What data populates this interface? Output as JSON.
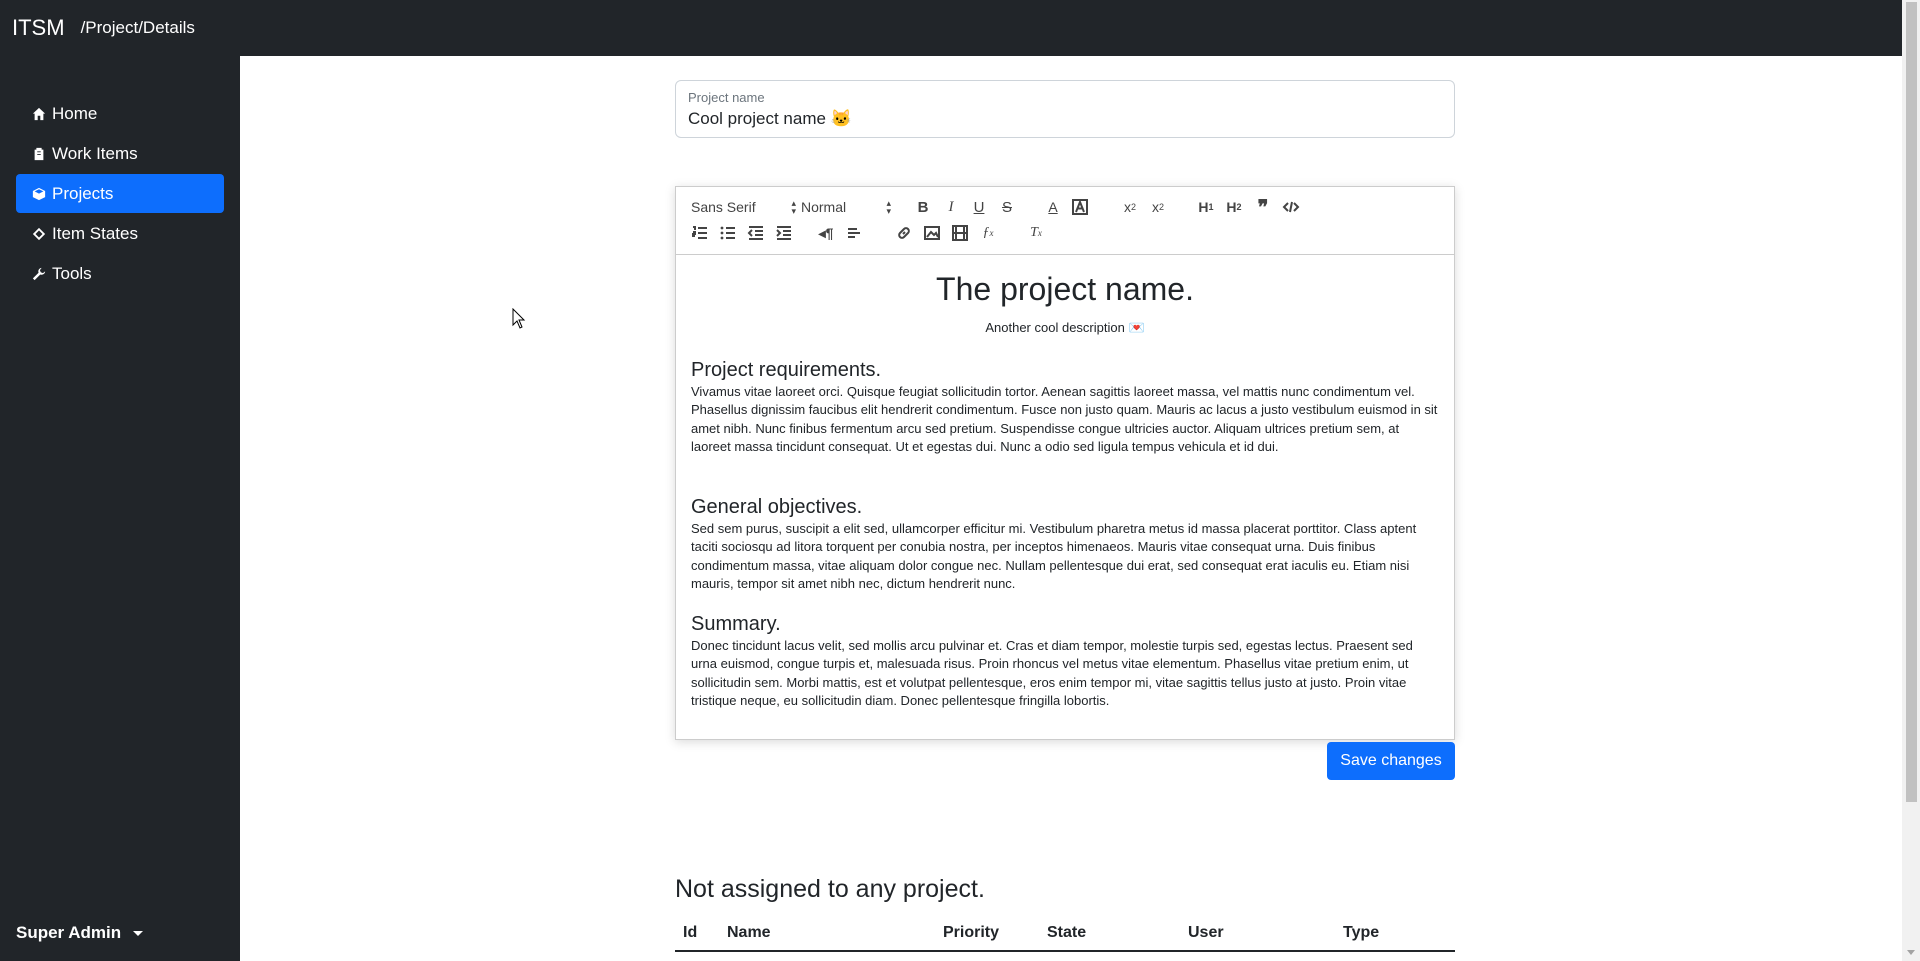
{
  "app": {
    "brand": "ITSM",
    "breadcrumb": "/Project/Details"
  },
  "sidebar": {
    "items": [
      {
        "label": "Home",
        "icon": "home-icon",
        "active": false
      },
      {
        "label": "Work Items",
        "icon": "clipboard-icon",
        "active": false
      },
      {
        "label": "Projects",
        "icon": "box-icon",
        "active": true
      },
      {
        "label": "Item States",
        "icon": "diamond-icon",
        "active": false
      },
      {
        "label": "Tools",
        "icon": "wrench-icon",
        "active": false
      }
    ],
    "user_menu": "Super Admin"
  },
  "project_field": {
    "label": "Project name",
    "value": "Cool project name 🐱"
  },
  "editor": {
    "font_select": "Sans Serif",
    "size_select": "Normal",
    "title": "The project name.",
    "description": "Another cool description 💌",
    "sections": [
      {
        "heading": "Project requirements.",
        "body": "Vivamus vitae laoreet orci. Quisque feugiat sollicitudin tortor. Aenean sagittis laoreet massa, vel mattis nunc condimentum vel. Phasellus dignissim faucibus elit hendrerit condimentum. Fusce non justo quam. Mauris ac lacus a justo vestibulum euismod in sit amet nibh. Nunc finibus fermentum arcu sed pretium. Suspendisse congue ultricies auctor. Aliquam ultrices pretium sem, at laoreet massa tincidunt consequat. Ut et egestas dui. Nunc a odio sed ligula tempus vehicula et id dui."
      },
      {
        "heading": "General objectives.",
        "body": "Sed sem purus, suscipit a elit sed, ullamcorper efficitur mi. Vestibulum pharetra metus id massa placerat porttitor. Class aptent taciti sociosqu ad litora torquent per conubia nostra, per inceptos himenaeos. Mauris vitae consequat urna. Duis finibus condimentum massa, vitae aliquam dolor congue nec. Nullam pellentesque dui erat, sed consequat erat iaculis eu. Etiam nisi mauris, tempor sit amet nibh nec, dictum hendrerit nunc."
      },
      {
        "heading": "Summary.",
        "body": "Donec tincidunt lacus velit, sed mollis arcu pulvinar et. Cras et diam tempor, molestie turpis sed, egestas lectus. Praesent sed urna euismod, congue turpis et, malesuada risus. Proin rhoncus vel metus vitae elementum. Phasellus vitae pretium enim, ut sollicitudin sem. Morbi mattis, est et volutpat pellentesque, eros enim tempor mi, vitae sagittis tellus justo at justo. Proin vitae tristique neque, eu sollicitudin diam. Donec pellentesque fringilla lobortis."
      }
    ]
  },
  "save_button": "Save changes",
  "unassigned": {
    "title": "Not assigned to any project.",
    "columns": [
      "Id",
      "Name",
      "Priority",
      "State",
      "User",
      "Type"
    ]
  },
  "colors": {
    "dark": "#212529",
    "primary": "#0d6efd"
  }
}
